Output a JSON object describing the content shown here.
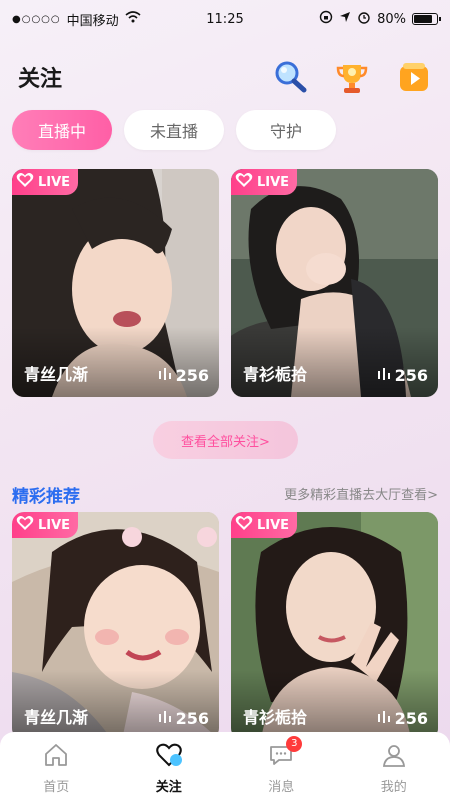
{
  "status_bar": {
    "carrier": "中国移动",
    "time": "11:25",
    "battery": "80%",
    "battery_level": 0.8
  },
  "header": {
    "title": "关注",
    "icons": [
      "search-icon",
      "trophy-icon",
      "play-video-icon"
    ]
  },
  "tabs": [
    {
      "label": "直播中",
      "active": true
    },
    {
      "label": "未直播",
      "active": false
    },
    {
      "label": "守护",
      "active": false
    }
  ],
  "following_cards": [
    {
      "badge": "LIVE",
      "name": "青丝几渐",
      "views": "256"
    },
    {
      "badge": "LIVE",
      "name": "青衫栀拾",
      "views": "256"
    }
  ],
  "see_all_label": "查看全部关注>",
  "recommend": {
    "title": "精彩推荐",
    "more_label": "更多精彩直播去大厅查看>"
  },
  "recommend_cards": [
    {
      "badge": "LIVE",
      "name": "青丝几渐",
      "views": "256"
    },
    {
      "badge": "LIVE",
      "name": "青衫栀拾",
      "views": "256"
    }
  ],
  "bottom_nav": [
    {
      "label": "首页",
      "icon": "home-icon",
      "active": false
    },
    {
      "label": "关注",
      "icon": "heart-icon",
      "active": true
    },
    {
      "label": "消息",
      "icon": "message-icon",
      "active": false,
      "badge": "3"
    },
    {
      "label": "我的",
      "icon": "user-icon",
      "active": false
    }
  ],
  "colors": {
    "accent_pink": "#ff5fa6",
    "live_badge": "#ff3f8a",
    "section_title_blue": "#2c6df0"
  }
}
